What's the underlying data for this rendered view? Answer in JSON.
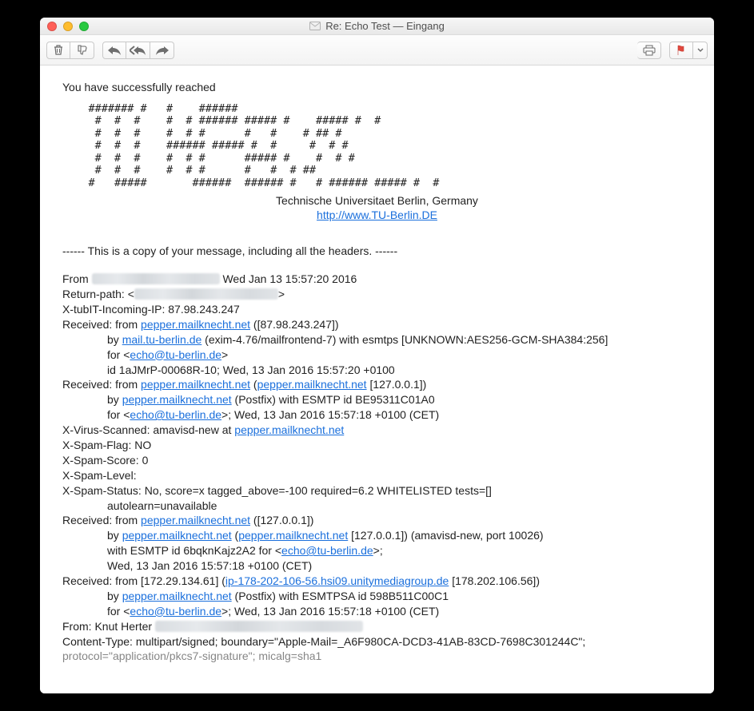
{
  "window": {
    "title": "Re: Echo Test — Eingang"
  },
  "body": {
    "intro": "You have successfully reached",
    "ascii": "    ####### #   #    ######\n     #  #  #    #  # ###### ##### #    ##### #  #\n     #  #  #    #  # #      #   #    # ## #\n     #  #  #    ###### ##### #  #     #  # #\n     #  #  #    #  # #      ##### #    #  # #\n     #  #  #    #  # #      #   #  # ##\n    #   #####       ######  ###### #   # ###### ##### #  #",
    "uni": "Technische Universitaet Berlin, Germany",
    "uni_link": "http://www.TU-Berlin.DE",
    "separator": "------ This is a copy of your message, including all the headers. ------"
  },
  "hdr": {
    "from_prefix": "From ",
    "from_suffix": " Wed Jan 13 15:57:20 2016",
    "rp_prefix": "Return-path: <",
    "rp_suffix": ">",
    "xip": "X-tubIT-Incoming-IP: 87.98.243.247",
    "r1a": "Received: from ",
    "r1a_link": "pepper.mailknecht.net",
    "r1a_tail": " ([87.98.243.247])",
    "r1b_pre": "by ",
    "r1b_link": "mail.tu-berlin.de",
    "r1b_tail": " (exim-4.76/mailfrontend-7) with esmtps [UNKNOWN:AES256-GCM-SHA384:256]",
    "r1c_pre": "for <",
    "r1c_link": "echo@tu-berlin.de",
    "r1c_tail": ">",
    "r1d": "id 1aJMrP-00068R-10; Wed, 13 Jan 2016 15:57:20 +0100",
    "r2a_pre": "Received: from ",
    "r2a_l1": "pepper.mailknecht.net",
    "r2a_mid": " (",
    "r2a_l2": "pepper.mailknecht.net",
    "r2a_tail": " [127.0.0.1])",
    "r2b_pre": "by ",
    "r2b_link": "pepper.mailknecht.net",
    "r2b_tail": " (Postfix) with ESMTP id BE95311C01A0",
    "r2c_pre": "for <",
    "r2c_link": "echo@tu-berlin.de",
    "r2c_tail": ">; Wed, 13 Jan 2016 15:57:18 +0100 (CET)",
    "xvs_pre": "X-Virus-Scanned: amavisd-new at ",
    "xvs_link": "pepper.mailknecht.net",
    "xsf": "X-Spam-Flag: NO",
    "xss": "X-Spam-Score: 0",
    "xsl": "X-Spam-Level:",
    "xst": "X-Spam-Status: No, score=x tagged_above=-100 required=6.2 WHITELISTED tests=[]",
    "xst2": "autolearn=unavailable",
    "r3a_pre": "Received: from ",
    "r3a_link": "pepper.mailknecht.net",
    "r3a_tail": " ([127.0.0.1])",
    "r3b_pre": "by ",
    "r3b_l1": "pepper.mailknecht.net",
    "r3b_mid": " (",
    "r3b_l2": "pepper.mailknecht.net",
    "r3b_tail": " [127.0.0.1]) (amavisd-new, port 10026)",
    "r3c_pre": "with ESMTP id 6bqknKajz2A2 for <",
    "r3c_link": "echo@tu-berlin.de",
    "r3c_tail": ">;",
    "r3d": "Wed, 13 Jan 2016 15:57:18 +0100 (CET)",
    "r4a_pre": "Received: from [172.29.134.61] (",
    "r4a_link": "ip-178-202-106-56.hsi09.unitymediagroup.de",
    "r4a_tail": " [178.202.106.56])",
    "r4b_pre": "by ",
    "r4b_link": "pepper.mailknecht.net",
    "r4b_tail": " (Postfix) with ESMTPSA id 598B511C00C1",
    "r4c_pre": "for <",
    "r4c_link": "echo@tu-berlin.de",
    "r4c_tail": ">; Wed, 13 Jan 2016 15:57:18 +0100 (CET)",
    "from2_pre": "From: Knut Herter ",
    "ct": "Content-Type: multipart/signed; boundary=\"Apple-Mail=_A6F980CA-DCD3-41AB-83CD-7698C301244C\";",
    "ct2": "protocol=\"application/pkcs7-signature\"; micalg=sha1"
  }
}
